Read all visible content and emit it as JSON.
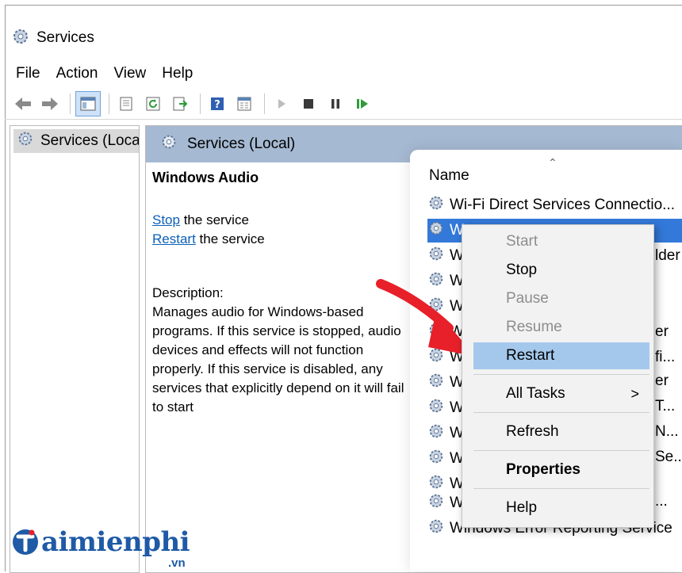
{
  "window": {
    "title": "Services"
  },
  "menu": [
    "File",
    "Action",
    "View",
    "Help"
  ],
  "toolbar": {
    "buttons": [
      "back-icon",
      "forward-icon",
      "show-hide-console-tree-icon",
      "export-list-icon",
      "refresh-icon",
      "export-icon",
      "help-icon",
      "properties-icon",
      "start-service-icon",
      "stop-service-icon",
      "pause-service-icon",
      "restart-service-icon"
    ]
  },
  "tree": {
    "selected": "Services (Local)"
  },
  "pane": {
    "header": "Services (Local)"
  },
  "detail": {
    "service_name": "Windows Audio",
    "stop_link": "Stop",
    "stop_rest": " the service",
    "restart_link": "Restart",
    "restart_rest": " the service",
    "desc_label": "Description:",
    "desc_text": "Manages audio for Windows-based programs.  If this service is stopped, audio devices and effects will not function properly.  If this service is disabled, any services that explicitly depend on it will fail to start"
  },
  "list": {
    "column": "Name",
    "rows": [
      "Wi-Fi Direct Services Connectio...",
      "W",
      "W",
      "W",
      "W",
      "W",
      "W",
      "W",
      "W",
      "W",
      "W",
      "W",
      "W",
      "Windows Error Reporting Service"
    ],
    "tails": [
      "lder",
      "er",
      "fi...",
      "er",
      "T...",
      "N...",
      "Se...",
      "..."
    ]
  },
  "context_menu": {
    "items": [
      {
        "label": "Start",
        "state": "disabled"
      },
      {
        "label": "Stop",
        "state": "enabled"
      },
      {
        "label": "Pause",
        "state": "disabled"
      },
      {
        "label": "Resume",
        "state": "disabled"
      },
      {
        "label": "Restart",
        "state": "highlighted"
      },
      {
        "label": "All Tasks",
        "state": "submenu"
      },
      {
        "label": "Refresh",
        "state": "enabled"
      },
      {
        "label": "Properties",
        "state": "default"
      },
      {
        "label": "Help",
        "state": "enabled"
      }
    ],
    "submenu_arrow": ">"
  },
  "watermark": {
    "brand": "aimienphi",
    "suffix": ".vn"
  },
  "colors": {
    "header": "#a5b9d2",
    "selection": "#3379d9",
    "highlight": "#a4c8ec",
    "arrow": "#e8202a",
    "link": "#0b5fb8"
  }
}
